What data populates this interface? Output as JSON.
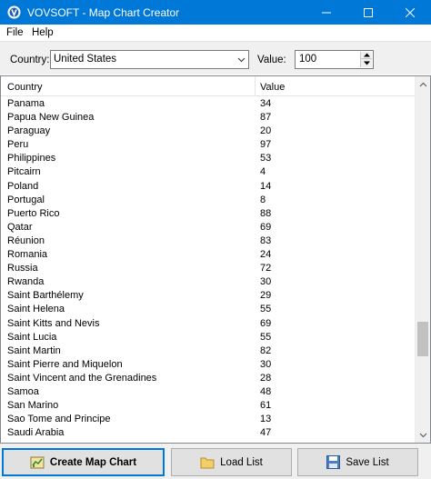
{
  "window": {
    "title": "VOVSOFT - Map Chart Creator"
  },
  "menu": {
    "file": "File",
    "help": "Help"
  },
  "toolbar": {
    "country_label": "Country:",
    "country_value": "United States",
    "value_label": "Value:",
    "value_value": "100"
  },
  "list": {
    "headers": {
      "country": "Country",
      "value": "Value"
    },
    "rows": [
      {
        "country": "Panama",
        "value": "34"
      },
      {
        "country": "Papua New Guinea",
        "value": "87"
      },
      {
        "country": "Paraguay",
        "value": "20"
      },
      {
        "country": "Peru",
        "value": "97"
      },
      {
        "country": "Philippines",
        "value": "53"
      },
      {
        "country": "Pitcairn",
        "value": "4"
      },
      {
        "country": "Poland",
        "value": "14"
      },
      {
        "country": "Portugal",
        "value": "8"
      },
      {
        "country": "Puerto Rico",
        "value": "88"
      },
      {
        "country": "Qatar",
        "value": "69"
      },
      {
        "country": "Réunion",
        "value": "83"
      },
      {
        "country": "Romania",
        "value": "24"
      },
      {
        "country": "Russia",
        "value": "72"
      },
      {
        "country": "Rwanda",
        "value": "30"
      },
      {
        "country": "Saint Barthélemy",
        "value": "29"
      },
      {
        "country": "Saint Helena",
        "value": "55"
      },
      {
        "country": "Saint Kitts and Nevis",
        "value": "69"
      },
      {
        "country": "Saint Lucia",
        "value": "55"
      },
      {
        "country": "Saint Martin",
        "value": "82"
      },
      {
        "country": "Saint Pierre and Miquelon",
        "value": "30"
      },
      {
        "country": "Saint Vincent and the Grenadines",
        "value": "28"
      },
      {
        "country": "Samoa",
        "value": "48"
      },
      {
        "country": "San Marino",
        "value": "61"
      },
      {
        "country": "Sao Tome and Principe",
        "value": "13"
      },
      {
        "country": "Saudi Arabia",
        "value": "47"
      }
    ]
  },
  "buttons": {
    "create": "Create Map Chart",
    "load": "Load List",
    "save": "Save List"
  },
  "colors": {
    "titlebar": "#0078d7",
    "accent": "#0078d7"
  }
}
